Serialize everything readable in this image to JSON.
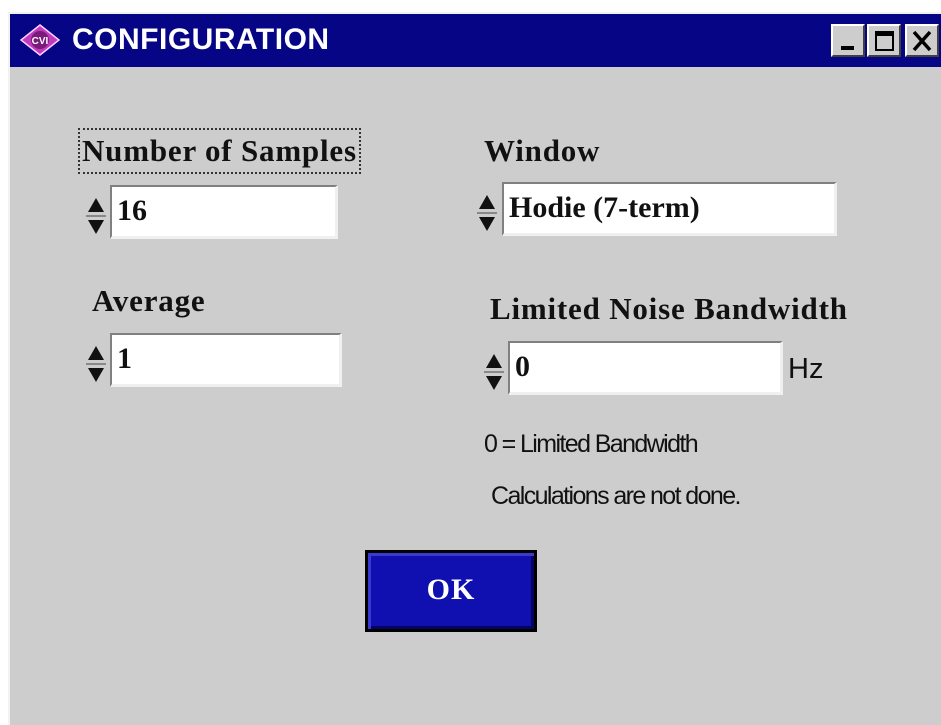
{
  "window": {
    "title": "CONFIGURATION",
    "icon_label": "CVI",
    "titlebar_color": "#050585",
    "controls": [
      "minimize-icon",
      "maximize-icon",
      "close-icon"
    ]
  },
  "fields": {
    "samples": {
      "label": "Number of Samples",
      "value": "16"
    },
    "window_fn": {
      "label": "Window",
      "value": "Hodie (7-term)"
    },
    "average": {
      "label": "Average",
      "value": "1"
    },
    "bandwidth": {
      "label": "Limited Noise Bandwidth",
      "value": "0",
      "unit": "Hz"
    }
  },
  "note": {
    "line1": "0 = Limited Bandwidth",
    "line2": "Calculations are not done."
  },
  "ok_button": {
    "label": "OK",
    "color": "#1010b0"
  }
}
